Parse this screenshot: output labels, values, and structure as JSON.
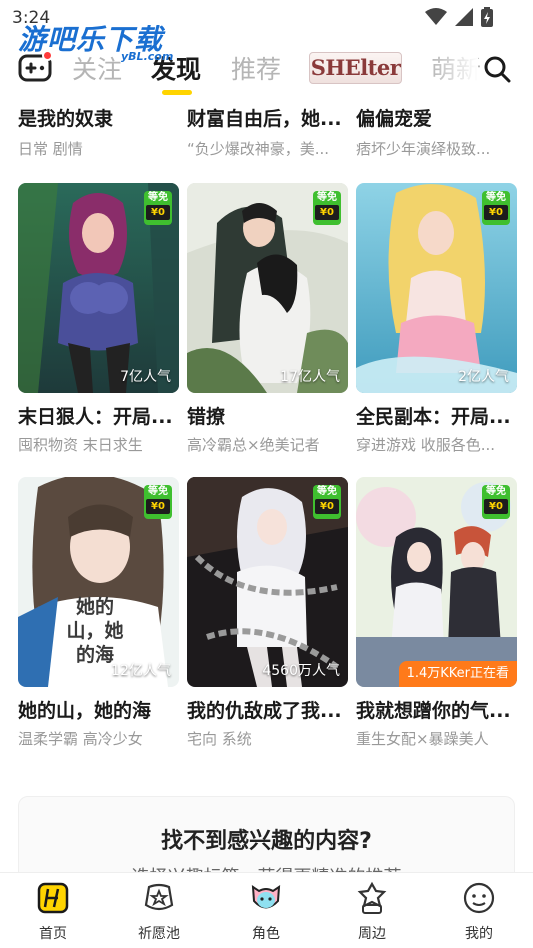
{
  "status": {
    "time": "3:24"
  },
  "watermark": {
    "main": "游吧乐下载",
    "sub": "yBL.com"
  },
  "nav": {
    "tabs": [
      {
        "label": "关注",
        "active": false
      },
      {
        "label": "发现",
        "active": true
      },
      {
        "label": "推荐",
        "active": false
      },
      {
        "label": "SHElter",
        "active": false
      },
      {
        "label": "萌新",
        "active": false
      }
    ]
  },
  "partial_row": [
    {
      "title": "是我的奴隶",
      "desc": "日常 剧情"
    },
    {
      "title": "财富自由后，她...",
      "desc": "“负少爆改神豪，美..."
    },
    {
      "title": "偏偏宠爱",
      "desc": "痞坏少年演绎极致..."
    }
  ],
  "cards": [
    {
      "title": "末日狠人：开局...",
      "desc": "囤积物资 末日求生",
      "free_top": "等免",
      "free_price": "¥0",
      "popularity": "7亿人气"
    },
    {
      "title": "错撩",
      "desc": "高冷霸总×绝美记者",
      "free_top": "等免",
      "free_price": "¥0",
      "popularity": "17亿人气"
    },
    {
      "title": "全民副本：开局...",
      "desc": "穿进游戏 收服各色...",
      "free_top": "等免",
      "free_price": "¥0",
      "popularity": "2亿人气"
    },
    {
      "title": "她的山，她的海",
      "desc": "温柔学霸 高冷少女",
      "free_top": "等免",
      "free_price": "¥0",
      "popularity": "12亿人气",
      "cover_text": "她的山，她的海"
    },
    {
      "title": "我的仇敌成了我...",
      "desc": "宅向 系统",
      "free_top": "等免",
      "free_price": "¥0",
      "popularity": "4560万人气"
    },
    {
      "title": "我就想蹭你的气...",
      "desc": "重生女配×暴躁美人",
      "free_top": "等免",
      "free_price": "¥0",
      "live": "1.4万KKer正在看"
    }
  ],
  "interest": {
    "title": "找不到感兴趣的内容?",
    "subtitle": "选择兴趣标签，获得更精准的推荐"
  },
  "bottom_nav": [
    {
      "label": "首页",
      "icon": "home-icon",
      "active": true
    },
    {
      "label": "祈愿池",
      "icon": "wish-pool-icon"
    },
    {
      "label": "角色",
      "icon": "character-icon"
    },
    {
      "label": "周边",
      "icon": "merch-icon"
    },
    {
      "label": "我的",
      "icon": "profile-icon"
    }
  ],
  "colors": {
    "accent": "#ffd400",
    "free_badge": "#3fbf2f",
    "live_badge": "#ff7a1a",
    "notification": "#ff3b3b"
  }
}
